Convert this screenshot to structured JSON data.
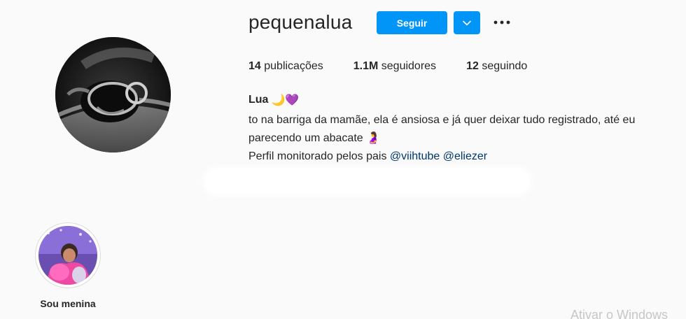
{
  "profile": {
    "username": "pequenalua",
    "follow_label": "Seguir",
    "dropdown_icon": "chevron-down-icon",
    "more_icon": "more-options-icon"
  },
  "stats": {
    "posts_count": "14",
    "posts_label": "publicações",
    "followers_count": "1.1M",
    "followers_label": "seguidores",
    "following_count": "12",
    "following_label": "seguindo"
  },
  "bio": {
    "name": "Lua",
    "name_emojis": "🌙💜",
    "line1": "to na barriga da mamãe, ela é ansiosa e já quer deixar tudo registrado, até eu",
    "line2": "parecendo um abacate 🤰",
    "line3_prefix": "Perfil monitorado pelos pais",
    "mention1": "@viihtube",
    "mention2": "@eliezer"
  },
  "highlights": [
    {
      "label": "Sou menina"
    }
  ],
  "watermark": "Ativar o Windows",
  "colors": {
    "accent": "#0095f6",
    "mention": "#00376b",
    "text": "#262626",
    "background": "#fafafa"
  }
}
